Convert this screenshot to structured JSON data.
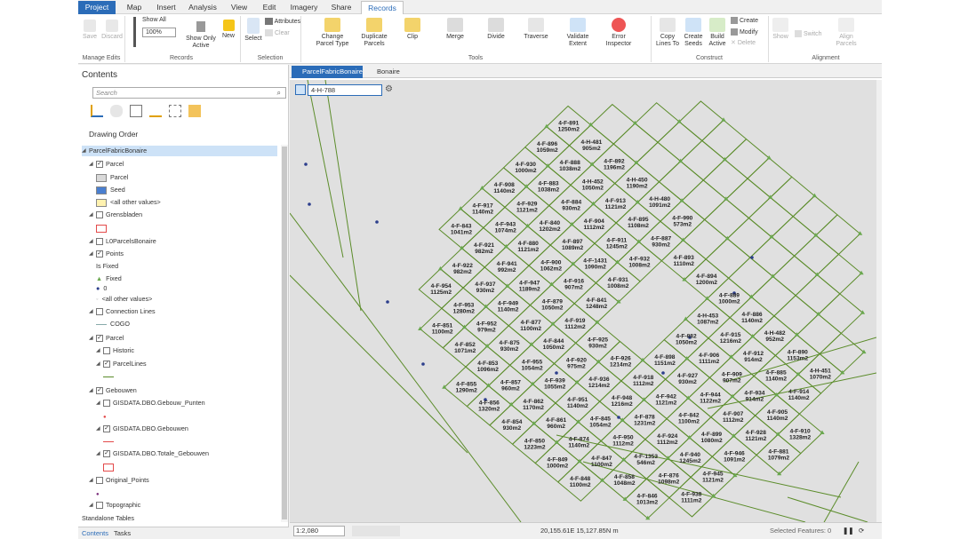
{
  "ribbon_tabs": [
    "Project",
    "Map",
    "Insert",
    "Analysis",
    "View",
    "Edit",
    "Imagery",
    "Share",
    "Records"
  ],
  "ribbon": {
    "manage_edits": {
      "save": "Save",
      "discard": "Discard",
      "group": "Manage Edits"
    },
    "records": {
      "show_all": "Show All",
      "zoom": "100%",
      "show_only_active_1": "Show Only",
      "show_only_active_2": "Active",
      "new": "New",
      "group": "Records"
    },
    "selection": {
      "select": "Select",
      "attributes": "Attributes",
      "clear": "Clear",
      "group": "Selection"
    },
    "tools": {
      "change_parcel_type_1": "Change",
      "change_parcel_type_2": "Parcel Type",
      "duplicate_parcels_1": "Duplicate",
      "duplicate_parcels_2": "Parcels",
      "clip": "Clip",
      "merge": "Merge",
      "divide": "Divide",
      "traverse": "Traverse",
      "validate_extent_1": "Validate",
      "validate_extent_2": "Extent",
      "error_inspector_1": "Error",
      "error_inspector_2": "Inspector",
      "group": "Tools"
    },
    "construct": {
      "copy_lines_to_1": "Copy",
      "copy_lines_to_2": "Lines To",
      "create_seeds_1": "Create",
      "create_seeds_2": "Seeds",
      "build_active_1": "Build",
      "build_active_2": "Active",
      "create": "Create",
      "modify": "Modify",
      "delete": "Delete",
      "group": "Construct"
    },
    "alignment": {
      "show": "Show",
      "switch": "Switch",
      "align_parcels_1": "Align",
      "align_parcels_2": "Parcels",
      "group": "Alignment"
    }
  },
  "contents": {
    "title": "Contents",
    "search_placeholder": "Search",
    "drawing_order": "Drawing Order",
    "items": [
      {
        "label": "ParcelFabricBonaire",
        "indent": 0,
        "checkbox": false,
        "selected": true
      },
      {
        "label": "Parcel",
        "indent": 1,
        "checkbox": true,
        "checked": true
      },
      {
        "label": "Parcel",
        "indent": 2,
        "swatch": "#d9d9d9"
      },
      {
        "label": "Seed",
        "indent": 2,
        "swatch": "#4a7fd0"
      },
      {
        "label": "<all other values>",
        "indent": 2,
        "swatch": "#fff2b0"
      },
      {
        "label": "Grensbladen",
        "indent": 1,
        "checkbox": true,
        "checked": false
      },
      {
        "label": "",
        "indent": 2,
        "swatch": "#e34a4a",
        "outline": true
      },
      {
        "label": "L0ParcelsBonaire",
        "indent": 1,
        "checkbox": true,
        "checked": false
      },
      {
        "label": "Points",
        "indent": 1,
        "checkbox": true,
        "checked": true
      },
      {
        "label": "Is Fixed",
        "indent": 2
      },
      {
        "label": "Fixed",
        "indent": 2,
        "marker": "triangle"
      },
      {
        "label": "0",
        "indent": 2,
        "marker": "dot"
      },
      {
        "label": "<all other values>",
        "indent": 2,
        "marker": "small"
      },
      {
        "label": "Connection Lines",
        "indent": 1,
        "checkbox": true,
        "checked": false
      },
      {
        "label": "COGO",
        "indent": 2,
        "marker": "line"
      },
      {
        "label": "Parcel",
        "indent": 1,
        "checkbox": true,
        "checked": true
      },
      {
        "label": "Historic",
        "indent": 2,
        "checkbox": true,
        "checked": false
      },
      {
        "label": "ParcelLines",
        "indent": 2,
        "checkbox": true,
        "checked": true
      },
      {
        "label": "",
        "indent": 3,
        "marker": "greenline"
      },
      {
        "label": "Gebouwen",
        "indent": 1,
        "checkbox": true,
        "checked": true
      },
      {
        "label": "GISDATA.DBO.Gebouw_Punten",
        "indent": 2,
        "checkbox": true,
        "checked": false
      },
      {
        "label": "",
        "indent": 3,
        "marker": "reddot"
      },
      {
        "label": "GISDATA.DBO.Gebouwen",
        "indent": 2,
        "checkbox": true,
        "checked": true
      },
      {
        "label": "",
        "indent": 3,
        "marker": "redline"
      },
      {
        "label": "GISDATA.DBO.Totale_Gebouwen",
        "indent": 2,
        "checkbox": true,
        "checked": true
      },
      {
        "label": "",
        "indent": 3,
        "swatch": "#e34a4a",
        "outline": true
      },
      {
        "label": "Original_Points",
        "indent": 1,
        "checkbox": true,
        "checked": false
      },
      {
        "label": "",
        "indent": 2,
        "marker": "purpledot"
      },
      {
        "label": "Topographic",
        "indent": 1,
        "checkbox": true,
        "checked": false
      },
      {
        "label": "Standalone Tables",
        "indent": 0
      }
    ],
    "bottom_tabs": [
      "Contents",
      "Tasks"
    ]
  },
  "map": {
    "tabs": [
      "ParcelFabricBonaire",
      "Bonaire"
    ],
    "record_name": "4-H-788",
    "scale": "1:2,080",
    "coords": "20,155.61E 15,127.85N m",
    "selected_features": "Selected Features: 0",
    "parcels": [
      [
        "4-F-855",
        "1290m2"
      ],
      [
        "4-F-856",
        "1320m2"
      ],
      [
        "4-F-854",
        "930m2"
      ],
      [
        "4-F-850",
        "1223m2"
      ],
      [
        "4-F-849",
        "1000m2"
      ],
      [
        "4-F-848",
        "1100m2"
      ],
      [
        "4-F-851",
        "1100m2"
      ],
      [
        "4-F-852",
        "1071m2"
      ],
      [
        "4-F-853",
        "1096m2"
      ],
      [
        "4-F-857",
        "960m2"
      ],
      [
        "4-F-862",
        "1170m2"
      ],
      [
        "4-F-861",
        "960m2"
      ],
      [
        "4-F-874",
        "1140m2"
      ],
      [
        "4-F-847",
        "1100m2"
      ],
      [
        "4-F-858",
        "1048m2"
      ],
      [
        "4-F-846",
        "1013m2"
      ],
      [
        "4-F-954",
        "1125m2"
      ],
      [
        "4-F-953",
        "1280m2"
      ],
      [
        "4-F-952",
        "979m2"
      ],
      [
        "4-F-875",
        "930m2"
      ],
      [
        "4-F-955",
        "1054m2"
      ],
      [
        "4-F-939",
        "1055m2"
      ],
      [
        "4-F-951",
        "1140m2"
      ],
      [
        "4-F-845",
        "1054m2"
      ],
      [
        "4-F-950",
        "1112m2"
      ],
      [
        "4-F-1353",
        "546m2"
      ],
      [
        "4-F-876",
        "1098m2"
      ],
      [
        "4-F-938",
        "1111m2"
      ],
      [
        "4-F-922",
        "982m2"
      ],
      [
        "4-F-937",
        "930m2"
      ],
      [
        "4-F-949",
        "1140m2"
      ],
      [
        "4-F-877",
        "1100m2"
      ],
      [
        "4-F-844",
        "1050m2"
      ],
      [
        "4-F-920",
        "975m2"
      ],
      [
        "4-F-936",
        "1214m2"
      ],
      [
        "4-F-948",
        "1216m2"
      ],
      [
        "4-F-878",
        "1231m2"
      ],
      [
        "4-F-924",
        "1112m2"
      ],
      [
        "4-F-940",
        "1245m2"
      ],
      [
        "4-F-945",
        "1121m2"
      ],
      [
        "4-F-843",
        "1041m2"
      ],
      [
        "4-F-921",
        "982m2"
      ],
      [
        "4-F-941",
        "992m2"
      ],
      [
        "4-F-947",
        "1189m2"
      ],
      [
        "4-F-879",
        "1050m2"
      ],
      [
        "4-F-919",
        "1112m2"
      ],
      [
        "4-F-925",
        "930m2"
      ],
      [
        "4-F-926",
        "1214m2"
      ],
      [
        "4-F-918",
        "1112m2"
      ],
      [
        "4-F-942",
        "1121m2"
      ],
      [
        "4-F-842",
        "1100m2"
      ],
      [
        "4-F-899",
        "1080m2"
      ],
      [
        "4-F-946",
        "1091m2"
      ],
      [
        "4-F-917",
        "1140m2"
      ],
      [
        "4-F-943",
        "1074m2"
      ],
      [
        "4-F-880",
        "1121m2"
      ],
      [
        "4-F-900",
        "1062m2"
      ],
      [
        "4-F-916",
        "907m2"
      ],
      [
        "4-F-841",
        "1248m2"
      ],
      [
        "4-F-898",
        "1151m2"
      ],
      [
        "4-F-927",
        "930m2"
      ],
      [
        "4-F-944",
        "1122m2"
      ],
      [
        "4-F-907",
        "1112m2"
      ],
      [
        "4-F-928",
        "1121m2"
      ],
      [
        "4-F-881",
        "1079m2"
      ],
      [
        "4-F-908",
        "1140m2"
      ],
      [
        "4-F-929",
        "1121m2"
      ],
      [
        "4-F-840",
        "1202m2"
      ],
      [
        "4-F-897",
        "1089m2"
      ],
      [
        "4-F-1431",
        "1090m2"
      ],
      [
        "4-F-931",
        "1008m2"
      ],
      [
        "4-F-882",
        "1050m2"
      ],
      [
        "4-F-906",
        "1111m2"
      ],
      [
        "4-F-909",
        "907m2"
      ],
      [
        "4-F-934",
        "914m2"
      ],
      [
        "4-F-905",
        "1140m2"
      ],
      [
        "4-F-910",
        "1328m2"
      ],
      [
        "4-F-930",
        "1000m2"
      ],
      [
        "4-F-883",
        "1038m2"
      ],
      [
        "4-F-884",
        "930m2"
      ],
      [
        "4-F-904",
        "1112m2"
      ],
      [
        "4-F-911",
        "1245m2"
      ],
      [
        "4-F-932",
        "1008m2"
      ],
      [
        "4-H-453",
        "1087m2"
      ],
      [
        "4-F-915",
        "1216m2"
      ],
      [
        "4-F-912",
        "914m2"
      ],
      [
        "4-F-885",
        "1140m2"
      ],
      [
        "4-F-914",
        "1140m2"
      ],
      [
        "4-F-896",
        "1059m2"
      ],
      [
        "4-F-888",
        "1038m2"
      ],
      [
        "4-H-452",
        "1050m2"
      ],
      [
        "4-F-913",
        "1121m2"
      ],
      [
        "4-F-895",
        "1108m2"
      ],
      [
        "4-F-887",
        "930m2"
      ],
      [
        "4-F-893",
        "1110m2"
      ],
      [
        "4-F-894",
        "1200m2"
      ],
      [
        "4-F-889",
        "1000m2"
      ],
      [
        "4-F-886",
        "1140m2"
      ],
      [
        "4-H-482",
        "952m2"
      ],
      [
        "4-F-890",
        "1153m2"
      ],
      [
        "4-H-451",
        "1070m2"
      ],
      [
        "4-F-891",
        "1250m2"
      ],
      [
        "4-H-481",
        "905m2"
      ],
      [
        "4-F-892",
        "1196m2"
      ],
      [
        "4-H-450",
        "1190m2"
      ],
      [
        "4-H-480",
        "1091m2"
      ],
      [
        "4-F-990",
        "573m2"
      ]
    ]
  },
  "colors": {
    "accent": "#2b6cb8",
    "line": "#5b8c2a",
    "triangle": "#6aa84f",
    "dot": "#2c3e8c",
    "map_bg": "#e0e0e0"
  }
}
